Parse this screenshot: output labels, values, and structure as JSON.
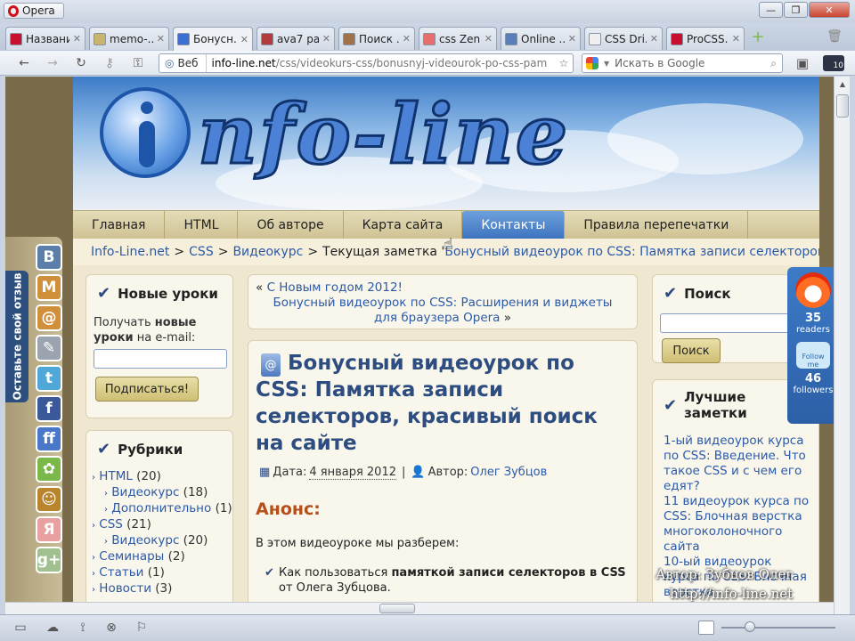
{
  "window": {
    "app_label": "Opera",
    "controls": {
      "minimize": "—",
      "restore": "❐",
      "close": "✕"
    }
  },
  "tabs": [
    {
      "label": "Названи...",
      "color": "#c8102e"
    },
    {
      "label": "memo-...",
      "color": "#c9b46e"
    },
    {
      "label": "Бонусн...",
      "color": "#3b6fd1",
      "active": true
    },
    {
      "label": "ava7 pa...",
      "color": "#b23b3b"
    },
    {
      "label": "Поиск ...",
      "color": "#a0734a"
    },
    {
      "label": "css Zen...",
      "color": "#e86d6d"
    },
    {
      "label": "Online ...",
      "color": "#5a7fb8"
    },
    {
      "label": "CSS Dri...",
      "color": "#f0f0f0"
    },
    {
      "label": "ProCSS...",
      "color": "#c8102e"
    }
  ],
  "nav": {
    "web_label": "Веб",
    "url_domain": "info-line.net",
    "url_path": "/css/videokurs-css/bonusnyj-videourok-po-css-pam",
    "search_placeholder": "Искать в Google",
    "badge_count": "10"
  },
  "site": {
    "logo_text": "nfo-line",
    "menu": [
      "Главная",
      "HTML",
      "Об авторе",
      "Карта сайта",
      "Контакты",
      "Правила перепечатки"
    ],
    "menu_active": "Контакты",
    "breadcrumb": {
      "home": "Info-Line.net",
      "sep": ">",
      "cat1": "CSS",
      "cat2": "Видеокурс",
      "current_prefix": "Текущая заметка '",
      "current_title": "Бонусный видеоурок по CSS: Памятка записи селекторов,...",
      "current_suffix": "'"
    }
  },
  "left": {
    "new_lessons": {
      "title": "Новые уроки",
      "text_pre": "Получать ",
      "text_bold": "новые уроки",
      "text_post": " на e-mail:",
      "button": "Подписаться!"
    },
    "rubrics": {
      "title": "Рубрики",
      "items": [
        {
          "label": "HTML",
          "count": "(20)",
          "indent": false
        },
        {
          "label": "Видеокурс",
          "count": "(18)",
          "indent": true
        },
        {
          "label": "Дополнительно",
          "count": "(1)",
          "indent": true
        },
        {
          "label": "CSS",
          "count": "(21)",
          "indent": false
        },
        {
          "label": "Видеокурс",
          "count": "(20)",
          "indent": true
        },
        {
          "label": "Семинары",
          "count": "(2)",
          "indent": false
        },
        {
          "label": "Статьи",
          "count": "(1)",
          "indent": false
        },
        {
          "label": "Новости",
          "count": "(3)",
          "indent": false
        }
      ]
    }
  },
  "post_nav": {
    "prev_arrow": "«",
    "prev": "С Новым годом 2012!",
    "next": "Бонусный видеоурок по CSS: Расширения и виджеты для браузера Opera",
    "next_arrow": "»"
  },
  "article": {
    "title": "Бонусный видеоурок по CSS: Памятка записи селекторов, красивый поиск на сайте",
    "date_label": "Дата:",
    "date": "4 января 2012",
    "sep": "|",
    "author_label": "Автор:",
    "author": "Олег Зубцов",
    "announce": "Анонс:",
    "intro": "В этом видеоуроке мы разберем:",
    "bullet_pre": "Как пользоваться ",
    "bullet_bold": "памяткой записи селекторов в CSS",
    "bullet_post": " от Олега Зубцова."
  },
  "right": {
    "search_title": "Поиск",
    "search_button": "Поиск",
    "best_title": "Лучшие заметки",
    "best": [
      "1-ый видеоурок курса по CSS: Введение. Что такое CSS и с чем его едят?",
      "11 видеоурок курса по CSS: Блочная верстка многоколоночного сайта",
      "10-ый видеоурок курса по CSS: Блочная верстка"
    ]
  },
  "rss": {
    "readers_count": "35",
    "readers_label": "readers",
    "followers_count": "46",
    "followers_label": "followers",
    "follow_badge": "Follow me"
  },
  "feedback_tab": "Оставьте свой отзыв",
  "social_letters": [
    "В",
    "М",
    "@",
    "✎",
    "t",
    "f",
    "ff",
    "✿",
    "☺",
    "Я",
    "g+"
  ],
  "watermark": {
    "line1": "Автор: Зубцов Олег",
    "line2": "http://info-line.net"
  }
}
